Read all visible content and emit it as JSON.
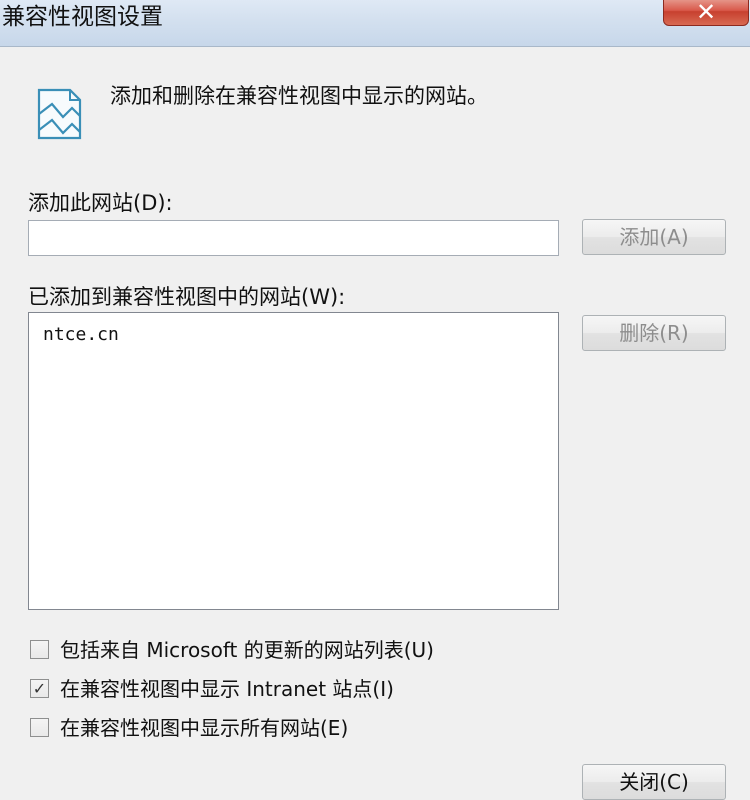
{
  "window": {
    "title": "兼容性视图设置",
    "close_glyph": "✕"
  },
  "description": "添加和删除在兼容性视图中显示的网站。",
  "add_site": {
    "label": "添加此网站(D):",
    "input_value": "",
    "add_button_label": "添加(A)"
  },
  "added_sites": {
    "label": "已添加到兼容性视图中的网站(W):",
    "items": [
      "ntce.cn"
    ],
    "remove_button_label": "删除(R)"
  },
  "options": [
    {
      "label": "包括来自 Microsoft 的更新的网站列表(U)",
      "checked": false
    },
    {
      "label": "在兼容性视图中显示 Intranet 站点(I)",
      "checked": true
    },
    {
      "label": "在兼容性视图中显示所有网站(E)",
      "checked": false
    }
  ],
  "close_button_label": "关闭(C)",
  "icons": {
    "app": "compat-view-page-icon",
    "check": "✓"
  }
}
